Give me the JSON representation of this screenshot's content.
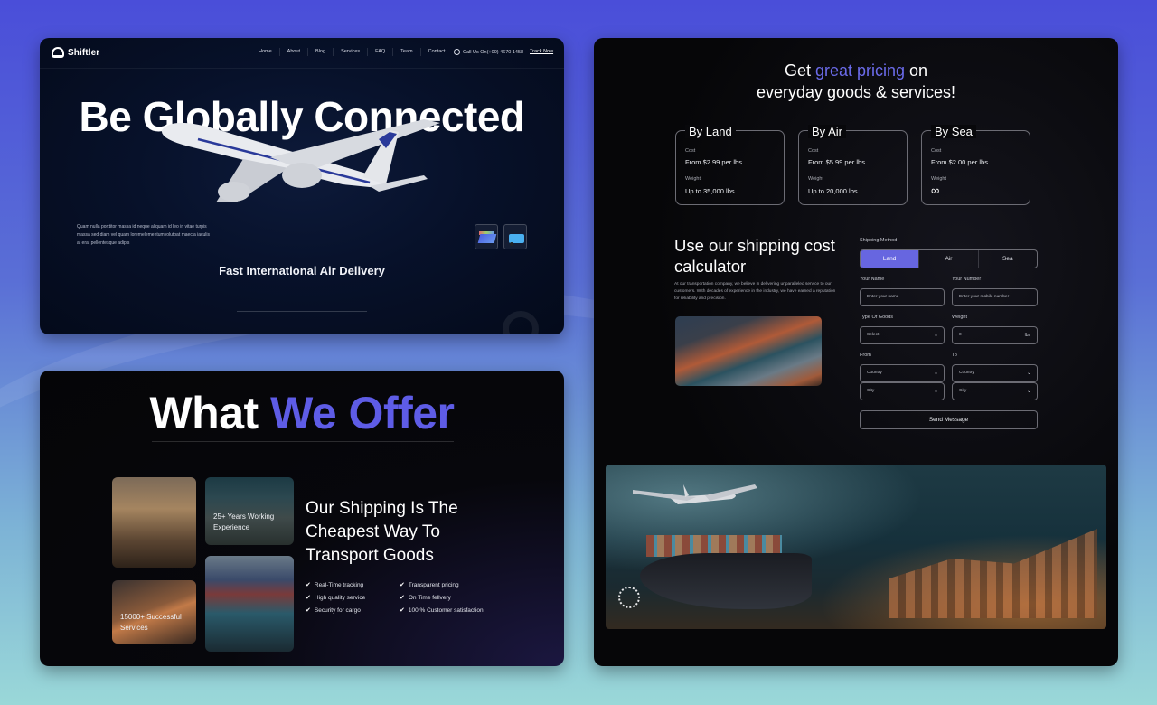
{
  "colors": {
    "accent": "#5e5ce6",
    "accent_button": "#6766e0"
  },
  "hero": {
    "logo_text": "Shiftler",
    "nav": [
      "Home",
      "About",
      "Blog",
      "Services",
      "FAQ",
      "Team",
      "Contact"
    ],
    "call_text": "Call Us On(+00) 4670 1458",
    "track_label": "Track Now",
    "title": "Be Globally Connected",
    "description": "Quam nulla porttitor massa id neque aliquam id leo in vitae turpis massa sed diam vel quam loremelementumvolutpat maecia iaculis at erat pellentesque adipis",
    "subtitle": "Fast International Air Delivery",
    "thumbnails": [
      "cargo-ship-thumbnail",
      "truck-thumbnail"
    ]
  },
  "offer": {
    "title_plain": "What ",
    "title_accent": "We Offer",
    "cards": [
      {
        "label": ""
      },
      {
        "label": "25+ Years Working Experience"
      },
      {
        "label": "15000+ Successful Services"
      },
      {
        "label": ""
      }
    ],
    "heading": "Our Shipping Is The Cheapest Way To Transport Goods",
    "features": [
      "Real-Time tracking",
      "Transparent pricing",
      "High quality service",
      "On Time fellvery",
      "Security for cargo",
      "100 % Customer satisfaction"
    ]
  },
  "pricing": {
    "head_pre": "Get ",
    "head_accent": "great pricing",
    "head_post": " on",
    "head_line2": "everyday goods & services!",
    "cards": [
      {
        "title": "By Land",
        "cost_label": "Cost",
        "cost": "From $2.99 per lbs",
        "weight_label": "Weight",
        "weight": "Up to 35,000 lbs"
      },
      {
        "title": "By Air",
        "cost_label": "Cost",
        "cost": "From $5.99 per lbs",
        "weight_label": "Weight",
        "weight": "Up to 20,000 lbs"
      },
      {
        "title": "By Sea",
        "cost_label": "Cost",
        "cost": "From $2.00 per lbs",
        "weight_label": "Weight",
        "weight": "∞"
      }
    ],
    "calc_title": "Use our shipping cost calculator",
    "calc_desc": "At our transportation company, we believe in delivering unparalleled service to our customers. With decades of experience in the industry, we have earned a reputation for reliability and precision.",
    "form": {
      "method_label": "Shipping Method",
      "methods": [
        "Land",
        "Air",
        "Sea"
      ],
      "active_method": "Land",
      "name_label": "Your Name",
      "name_placeholder": "Enter your name",
      "number_label": "Your Number",
      "number_placeholder": "Enter your mobile number",
      "goods_label": "Type Of Goods",
      "goods_value": "Select",
      "weight_label": "Weight",
      "weight_value": "0",
      "weight_unit": "lbs",
      "from_label": "From",
      "to_label": "To",
      "country_placeholder": "Country",
      "city_placeholder": "City",
      "submit_label": "Send Message"
    }
  }
}
